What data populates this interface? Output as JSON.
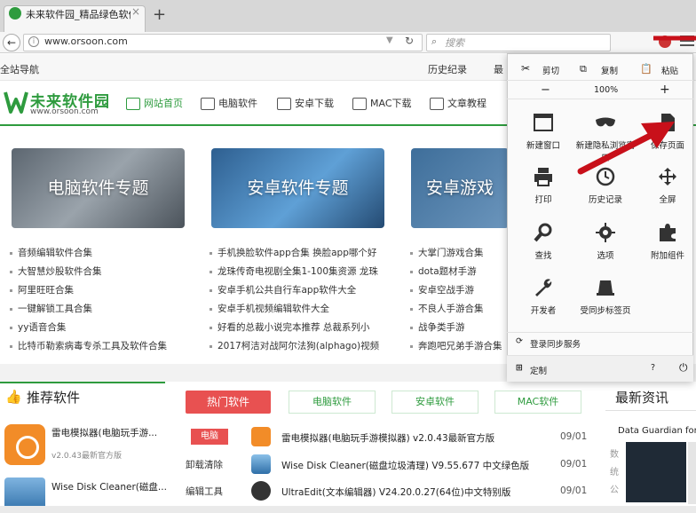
{
  "browser": {
    "tab_title": "未来软件园_精品绿色软件下",
    "tab_close": "×",
    "new_tab": "+",
    "url": "www.orsoon.com",
    "search_placeholder": "搜索"
  },
  "site": {
    "top_nav": "全站导航",
    "history": "历史纪录",
    "more": "最",
    "logo_cn": "未来软件园",
    "logo_en": "www.orsoon.com",
    "nav": [
      "网站首页",
      "电脑软件",
      "安卓下载",
      "MAC下载",
      "文章教程"
    ],
    "banners": [
      "电脑软件专题",
      "安卓软件专题",
      "安卓游戏"
    ],
    "col1": [
      "音频编辑软件合集",
      "大智慧炒股软件合集",
      "阿里旺旺合集",
      "一键解锁工具合集",
      "yy语音合集",
      "比特币勒索病毒专杀工具及软件合集"
    ],
    "col2": [
      "手机换脸软件app合集 换脸app哪个好",
      "龙珠传奇电视剧全集1-100集资源 龙珠",
      "安卓手机公共自行车app软件大全",
      "安卓手机视频编辑软件大全",
      "好看的总裁小说完本推荐 总裁系列小",
      "2017柯洁对战阿尔法狗(alphago)视频"
    ],
    "col3": [
      "大掌门游戏合集",
      "dota题材手游",
      "安卓空战手游",
      "不良人手游合集",
      "战争类手游",
      "奔跑吧兄弟手游合集"
    ]
  },
  "recommend": {
    "title": "推荐软件",
    "items": [
      {
        "name": "雷电模拟器(电脑玩手游...",
        "sub": "v2.0.43最新官方版"
      },
      {
        "name": "Wise Disk Cleaner(磁盘..."
      }
    ]
  },
  "hot": {
    "tabs": [
      "热门软件",
      "电脑软件",
      "安卓软件",
      "MAC软件"
    ],
    "categories": [
      "电脑",
      "卸载清除",
      "编辑工具"
    ],
    "rows": [
      {
        "name": "雷电模拟器(电脑玩手游模拟器) v2.0.43最新官方版",
        "date": "09/01"
      },
      {
        "name": "Wise Disk Cleaner(磁盘垃圾清理) V9.55.677 中文绿色版",
        "date": "09/01"
      },
      {
        "name": "UltraEdit(文本编辑器) V24.20.0.27(64位)中文特别版",
        "date": "09/01"
      }
    ]
  },
  "news": {
    "title": "最新资讯",
    "item": "Data Guardian for M",
    "bits": [
      "数",
      "统",
      "公"
    ]
  },
  "menu": {
    "cut": "剪切",
    "copy": "复制",
    "paste": "粘贴",
    "zoom_out": "−",
    "zoom": "100%",
    "zoom_in": "+",
    "grid": [
      [
        "新建窗口",
        "新建隐私浏览窗口",
        "保存页面"
      ],
      [
        "打印",
        "历史记录",
        "全屏"
      ],
      [
        "查找",
        "选项",
        "附加组件"
      ],
      [
        "开发者",
        "受同步标签页"
      ]
    ],
    "sync": "登录同步服务",
    "customize": "定制"
  },
  "colors": {
    "accent": "#2e9b3e",
    "hot": "#e85151",
    "arrow": "#c8101a"
  }
}
